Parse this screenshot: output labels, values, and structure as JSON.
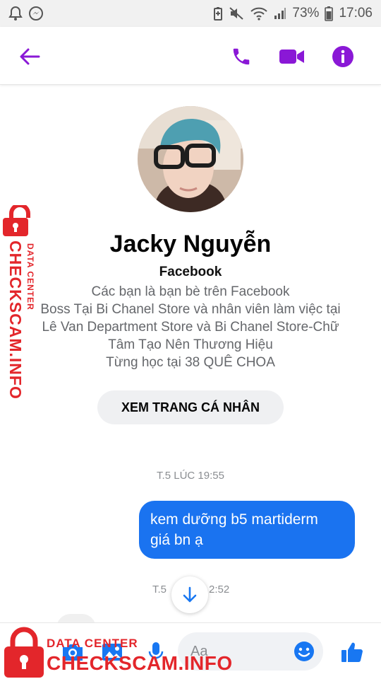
{
  "status_bar": {
    "battery": "73%",
    "time": "17:06"
  },
  "header": {
    "back_icon": "arrow-left-icon",
    "call_icon": "phone-icon",
    "video_icon": "video-camera-icon",
    "info_icon": "info-icon",
    "accent_color": "#8a18d6"
  },
  "profile": {
    "name": "Jacky Nguyễn",
    "platform": "Facebook",
    "lines": [
      "Các bạn là bạn bè trên Facebook",
      "Boss Tại Bi Chanel Store và nhân viên làm việc tại",
      "Lê Van  Department Store và Bi Chanel Store-Chữ",
      "Tâm Tạo Nên Thương Hiệu",
      "Từng học tại 38 QUÊ CHOA"
    ],
    "view_profile_label": "XEM TRANG CÁ NHÂN"
  },
  "messages": {
    "timestamp_1": "T.5 LÚC 19:55",
    "outgoing_1": [
      "kem dưỡng b5 martiderm",
      "giá bn ạ"
    ],
    "timestamp_2_left": "T.5",
    "timestamp_2_right": "2:52",
    "bubble_color": "#1a73f0"
  },
  "composer": {
    "placeholder": "Aa",
    "icons": [
      "camera-icon",
      "image-icon",
      "microphone-icon",
      "emoji-icon",
      "thumbs-up-icon"
    ],
    "accent_color": "#1877f2"
  },
  "watermark": {
    "side_big": "CHECKSCAM.INFO",
    "side_small": "DATA CENTER",
    "bottom_small": "DATA CENTER",
    "bottom_big": "CHECKSCAM.INFO",
    "color": "#e3262b"
  }
}
